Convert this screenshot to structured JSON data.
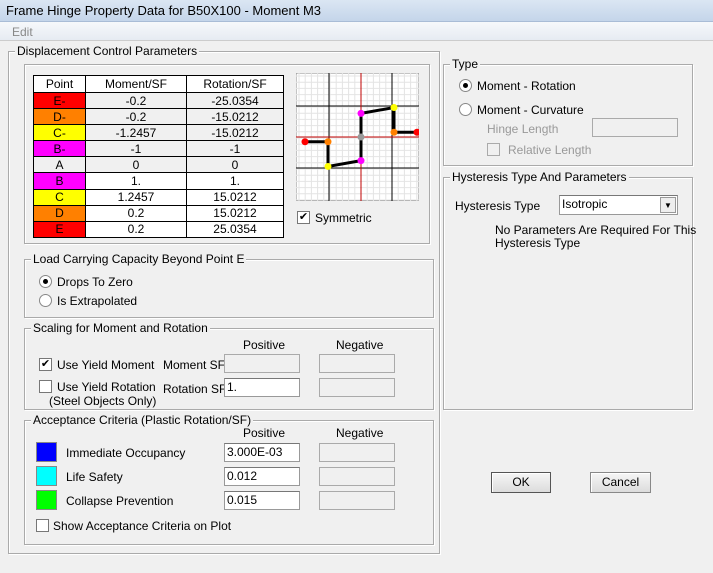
{
  "window": {
    "title": "Frame Hinge Property Data for B50X100 - Moment M3"
  },
  "menu": {
    "edit": "Edit"
  },
  "displacement": {
    "title": "Displacement Control Parameters",
    "columns": [
      "Point",
      "Moment/SF",
      "Rotation/SF"
    ],
    "rows": [
      {
        "point": "E-",
        "moment": "-0.2",
        "rotation": "-25.0354",
        "color": "#ff0000"
      },
      {
        "point": "D-",
        "moment": "-0.2",
        "rotation": "-15.0212",
        "color": "#ff8000"
      },
      {
        "point": "C-",
        "moment": "-1.2457",
        "rotation": "-15.0212",
        "color": "#ffff00"
      },
      {
        "point": "B-",
        "moment": "-1",
        "rotation": "-1",
        "color": "#ff00ff"
      },
      {
        "point": "A",
        "moment": "0",
        "rotation": "0",
        "color": "#f0f0f0"
      },
      {
        "point": "B",
        "moment": "1.",
        "rotation": "1.",
        "color": "#ff00ff"
      },
      {
        "point": "C",
        "moment": "1.2457",
        "rotation": "15.0212",
        "color": "#ffff00"
      },
      {
        "point": "D",
        "moment": "0.2",
        "rotation": "15.0212",
        "color": "#ff8000"
      },
      {
        "point": "E",
        "moment": "0.2",
        "rotation": "25.0354",
        "color": "#ff0000"
      }
    ],
    "symmetric": {
      "label": "Symmetric",
      "checked": true
    }
  },
  "load_capacity": {
    "title": "Load Carrying Capacity Beyond Point E",
    "options": [
      "Drops To Zero",
      "Is Extrapolated"
    ],
    "selected": 0
  },
  "scaling": {
    "title": "Scaling for Moment and Rotation",
    "positive": "Positive",
    "negative": "Negative",
    "use_yield_moment": {
      "label": "Use Yield Moment",
      "checked": true
    },
    "use_yield_rotation": {
      "label": "Use Yield Rotation",
      "sub": "(Steel Objects Only)",
      "checked": false
    },
    "moment_sf": {
      "label": "Moment SF",
      "positive": "",
      "negative": ""
    },
    "rotation_sf": {
      "label": "Rotation SF",
      "positive": "1.",
      "negative": ""
    }
  },
  "acceptance": {
    "title": "Acceptance Criteria (Plastic Rotation/SF)",
    "positive": "Positive",
    "negative": "Negative",
    "items": [
      {
        "label": "Immediate Occupancy",
        "color": "#0000ff",
        "positive": "3.000E-03",
        "negative": ""
      },
      {
        "label": "Life Safety",
        "color": "#00ffff",
        "positive": "0.012",
        "negative": ""
      },
      {
        "label": "Collapse Prevention",
        "color": "#00ff00",
        "positive": "0.015",
        "negative": ""
      }
    ],
    "show_on_plot": {
      "label": "Show Acceptance Criteria on Plot",
      "checked": false
    }
  },
  "type": {
    "title": "Type",
    "options": [
      "Moment - Rotation",
      "Moment - Curvature"
    ],
    "selected": 0,
    "hinge_length": {
      "label": "Hinge Length",
      "value": ""
    },
    "relative_length": {
      "label": "Relative Length",
      "checked": false
    }
  },
  "hysteresis": {
    "title": "Hysteresis Type And Parameters",
    "label": "Hysteresis Type",
    "value": "Isotropic",
    "note1": "No Parameters Are Required For This",
    "note2": "Hysteresis Type"
  },
  "buttons": {
    "ok": "OK",
    "cancel": "Cancel"
  }
}
